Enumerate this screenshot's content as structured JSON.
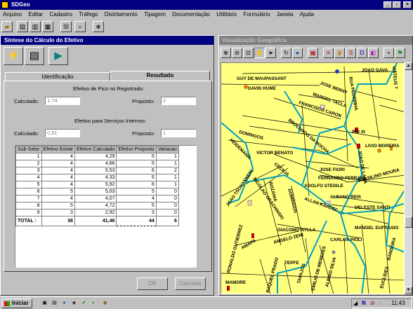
{
  "app": {
    "title": "SDGeo",
    "min_label": "_",
    "max_label": "▫",
    "close_label": "×"
  },
  "menu": [
    "Arquivo",
    "Editar",
    "Cadastro",
    "Tráfego",
    "Distritamento",
    "Tipagem",
    "Documentação",
    "Utilitário",
    "Formulário",
    "Janela",
    "Ajuda"
  ],
  "left": {
    "title": "Síntese do Cálculo do Efetivo",
    "tabs": {
      "identificacao": "Identificação",
      "resultado": "Resultado"
    },
    "pico_heading": "Efetivo de Pico no Registrado:",
    "servicos_heading": "Efetivo para Serviços Internos:",
    "calculado_label": "Calculado:",
    "proposto_label": "Proposto:",
    "pico_calculado": "1,74",
    "pico_proposto": "2",
    "serv_calculado": "0,91",
    "serv_proposto": "1",
    "headers": [
      "Sub-Setor",
      "Efetivo Existe",
      "Efetivo Calculado",
      "Efetivo Proposto",
      "Variacao"
    ],
    "rows": [
      [
        "1",
        "4",
        "4,29",
        "5",
        "1"
      ],
      [
        "2",
        "4",
        "4,66",
        "5",
        "1"
      ],
      [
        "3",
        "4",
        "5,53",
        "6",
        "2"
      ],
      [
        "4",
        "4",
        "4,33",
        "5",
        "1"
      ],
      [
        "5",
        "4",
        "5,92",
        "6",
        "1"
      ],
      [
        "6",
        "5",
        "5,03",
        "5",
        "0"
      ],
      [
        "7",
        "4",
        "4,07",
        "4",
        "0"
      ],
      [
        "8",
        "5",
        "4,72",
        "5",
        "0"
      ],
      [
        "9",
        "3",
        "2,92",
        "3",
        "0"
      ]
    ],
    "total": [
      "TOTAL :",
      "38",
      "41,46",
      "44",
      "6"
    ],
    "ok_label": "OK",
    "cancel_label": "Cancelar"
  },
  "right": {
    "title": "Visualização Geográfica",
    "streets": [
      "GUY DE MAUPASSANT",
      "DAVID HUME",
      "JOSE BERNY",
      "MANOEL TACLA",
      "FRANCISCO CARON",
      "RUA PEDRINHA",
      "MATEUS ?",
      "JOAO GAVA",
      "PIO XI",
      "DOMINGOS",
      "BROCHADO DA ROCHA",
      "LIVIO MOREIRA",
      "HEIDEMANN",
      "VICTOR BENATO",
      "JOAO DE LARA",
      "JOSE FIORI",
      "FERNANDO FERRARI",
      "BRASILINO MOURA",
      "CECILIA",
      "ADOLFO STEDILE",
      "JOAO TSCHANNERL",
      "ROZANIA",
      "NICOLAO GRACHINSKI",
      "DOMINGOS",
      "ALBANO REIS",
      "ALLAN KARDEC",
      "DELESTE SANTI",
      "MANOEL EUFRASIO",
      "GIACOMO NYLLA",
      "ANGELO ZENI",
      "CARLOS PIOLI",
      "AMAPA",
      "RONALDO GUTIERREZ",
      "TEPFE",
      "TAPAJOS",
      "EMILIO DE MENEZES",
      "ALBINO SILVA",
      "BANDEIRA",
      "EUCLIDES",
      "MAMORE",
      "RAQUEL PRADO"
    ]
  },
  "taskbar": {
    "start": "Iniciar",
    "clock": "11:43",
    "tray_text": "N"
  }
}
